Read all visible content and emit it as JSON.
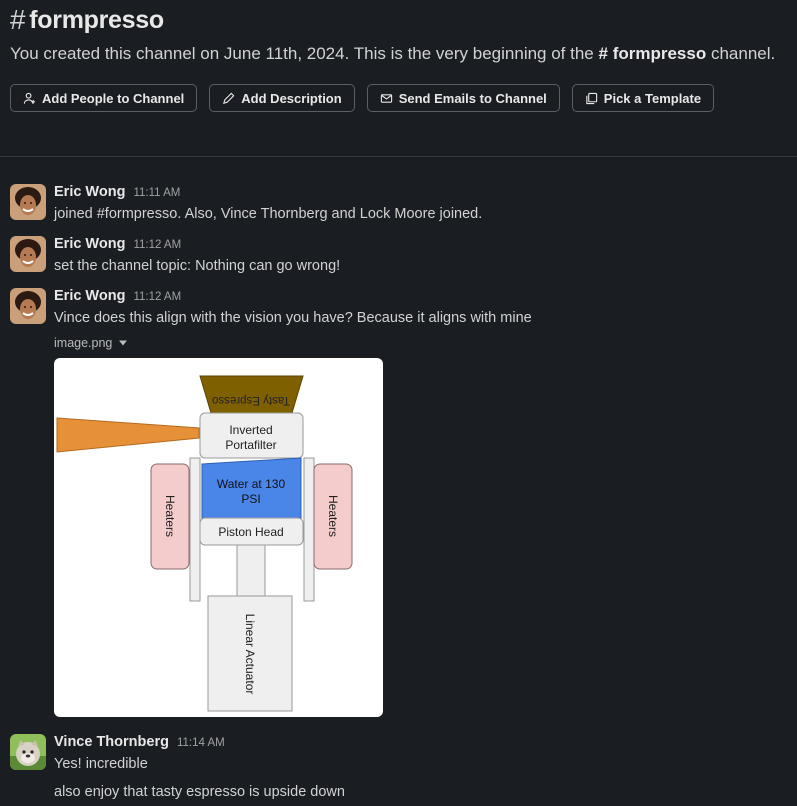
{
  "channel": {
    "hash": "#",
    "name": "formpresso",
    "intro_prefix": "You created this channel on June 11th, 2024. This is the very beginning of the",
    "intro_hash": "#",
    "intro_name": "formpresso",
    "intro_suffix": "channel."
  },
  "actions": {
    "add_people": "Add People to Channel",
    "add_description": "Add Description",
    "send_emails": "Send Emails to Channel",
    "pick_template": "Pick a Template"
  },
  "messages": [
    {
      "author": "Eric Wong",
      "time": "11:11 AM",
      "text": "joined #formpresso. Also, Vince Thornberg and Lock Moore joined."
    },
    {
      "author": "Eric Wong",
      "time": "11:12 AM",
      "text": "set the channel topic: Nothing can go wrong!"
    },
    {
      "author": "Eric Wong",
      "time": "11:12 AM",
      "text": "Vince does this align with the vision you have? Because it aligns with mine",
      "attachment": "image.png"
    },
    {
      "author": "Vince Thornberg",
      "time": "11:14 AM",
      "text": "Yes! incredible",
      "text2": "also enjoy that tasty espresso is upside down"
    }
  ],
  "diagram": {
    "tasty_espresso": "Tasty Espresso",
    "inverted_portafilter_1": "Inverted",
    "inverted_portafilter_2": "Portafilter",
    "water_1": "Water at 130",
    "water_2": "PSI",
    "piston_head": "Piston Head",
    "heaters_left": "Heaters",
    "heaters_right": "Heaters",
    "linear_actuator": "Linear Actuator"
  },
  "colors": {
    "background": "#1a1d21",
    "water": "#4a86e8",
    "heaters": "#f4cccc",
    "espresso": "#7f6000",
    "spout": "#e69138"
  }
}
